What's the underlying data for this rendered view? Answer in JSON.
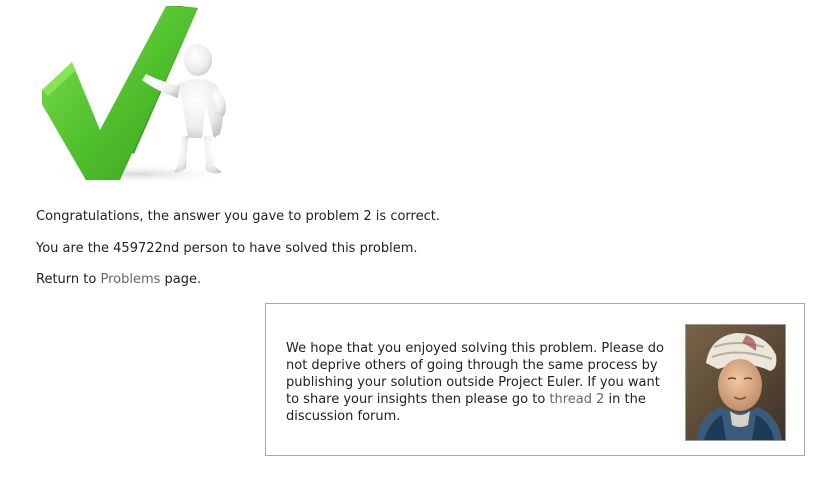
{
  "result": {
    "congrats_text": "Congratulations, the answer you gave to problem 2 is correct.",
    "solver_text": "You are the 459722nd person to have solved this problem.",
    "return_prefix": "Return to ",
    "problems_link": "Problems",
    "return_suffix": " page."
  },
  "info_box": {
    "text_before_link": "We hope that you enjoyed solving this problem. Please do not deprive others of going through the same process by publishing your solution outside Project Euler. If you want to share your insights then please go to ",
    "thread_link": "thread 2",
    "text_after_link": " in the discussion forum."
  },
  "colors": {
    "check_green": "#5cc43a",
    "link_gray": "#666666",
    "text": "#222222",
    "box_border": "#aaaaaa"
  },
  "icons": {
    "hero": "checkmark-with-figure-icon",
    "portrait": "euler-portrait-image"
  }
}
